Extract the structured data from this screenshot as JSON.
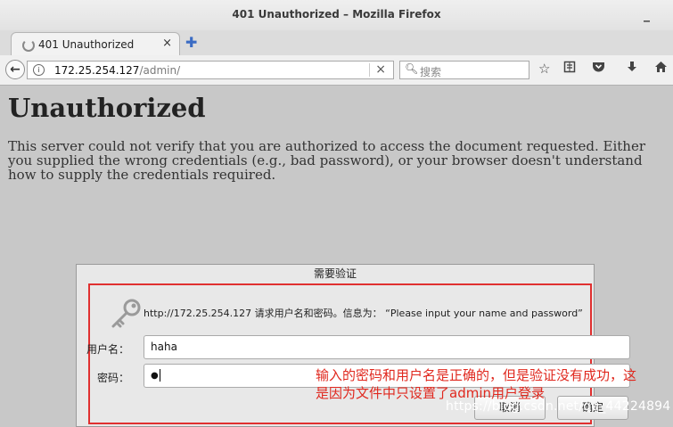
{
  "window": {
    "title": "401 Unauthorized – Mozilla Firefox",
    "minimize_glyph": "_"
  },
  "tabs": [
    {
      "label": "401 Unauthorized",
      "close_glyph": "×"
    }
  ],
  "new_tab_glyph": "✚",
  "navbar": {
    "back_glyph": "←",
    "url_host": "172.25.254.127",
    "url_path": "/admin/",
    "clear_glyph": "×",
    "search_placeholder": "搜索",
    "icons": [
      "star-icon",
      "reading-list-icon",
      "pocket-icon",
      "download-icon",
      "home-icon"
    ]
  },
  "page": {
    "heading": "Unauthorized",
    "body": "This server could not verify that you are authorized to access the document requested. Either you supplied the wrong credentials (e.g., bad password), or your browser doesn't understand how to supply the credentials required."
  },
  "dialog": {
    "title": "需要验证",
    "message": "http://172.25.254.127 请求用户名和密码。信息为： “Please input your name and password”",
    "username_label": "用户名：",
    "username_value": "haha",
    "password_label": "密码：",
    "password_value": "●",
    "cancel_label": "取消",
    "ok_label": "确定"
  },
  "annotation": {
    "line1": "输入的密码和用户名是正确的，但是验证没有成功，这",
    "line2": "是因为文件中只设置了admin用户登录"
  },
  "watermark": "https://blog.csdn.net/qq_44224894",
  "colors": {
    "annotation": "#e0281e",
    "highlight_box": "#e03030",
    "accent": "#3b6cc4"
  }
}
